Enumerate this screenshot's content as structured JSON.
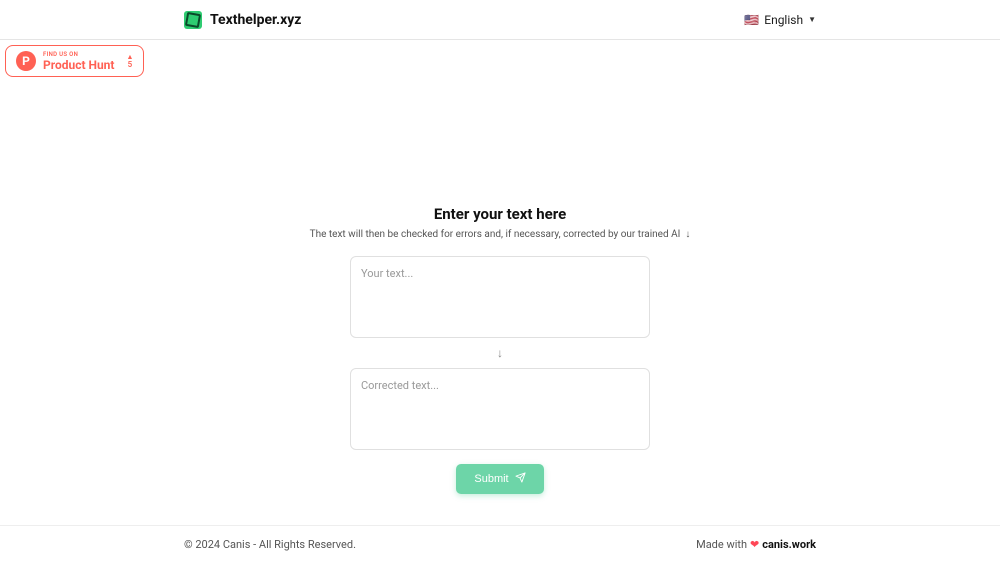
{
  "header": {
    "brand": "Texthelper.xyz",
    "lang_label": "English",
    "flag": "🇺🇸"
  },
  "product_hunt": {
    "top_label": "FIND US ON",
    "bottom_label": "Product Hunt",
    "letter": "P",
    "upvote_count": "5"
  },
  "main": {
    "title": "Enter your text here",
    "subtitle": "The text will then be checked for errors and, if necessary, corrected by our trained AI",
    "input_placeholder": "Your text...",
    "output_placeholder": "Corrected text...",
    "submit_label": "Submit"
  },
  "footer": {
    "copyright": "© 2024 Canis - All Rights Reserved.",
    "made_with_prefix": "Made with",
    "canis_link": "canis.work"
  }
}
